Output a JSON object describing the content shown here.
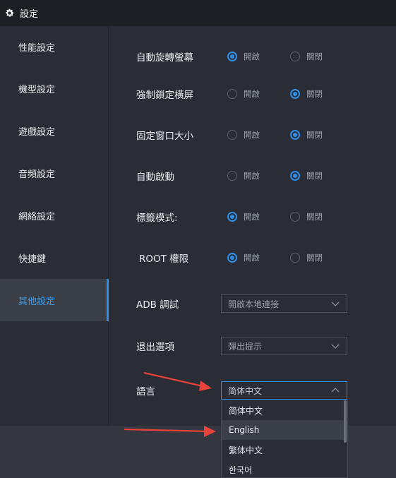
{
  "window": {
    "title": "設定"
  },
  "sidebar": {
    "items": [
      {
        "label": "性能設定",
        "active": false
      },
      {
        "label": "機型設定",
        "active": false
      },
      {
        "label": "遊戲設定",
        "active": false
      },
      {
        "label": "音頻設定",
        "active": false
      },
      {
        "label": "網絡設定",
        "active": false
      },
      {
        "label": "快捷鍵",
        "active": false
      },
      {
        "label": "其他設定",
        "active": true
      }
    ]
  },
  "settings": {
    "rows": [
      {
        "label": "自動旋轉螢幕",
        "on": "開啟",
        "off": "關閉",
        "selected": "on"
      },
      {
        "label": "強制鎖定橫屏",
        "on": "開啟",
        "off": "關閉",
        "selected": "off"
      },
      {
        "label": "固定窗口大小",
        "on": "開啟",
        "off": "關閉",
        "selected": "off"
      },
      {
        "label": "自動啟動",
        "on": "開啟",
        "off": "關閉",
        "selected": "off"
      },
      {
        "label": "標籤模式:",
        "on": "開啟",
        "off": "關閉",
        "selected": "on"
      },
      {
        "label": "ROOT 權限",
        "on": "開啟",
        "off": "關閉",
        "selected": "on"
      }
    ],
    "adb": {
      "label": "ADB 調試",
      "value": "開啟本地連接"
    },
    "exit": {
      "label": "退出選項",
      "value": "彈出提示"
    },
    "language": {
      "label": "語言",
      "value": "简体中文",
      "options": [
        "简体中文",
        "English",
        "繁体中文",
        "한국어"
      ],
      "hovered": "English"
    }
  },
  "colors": {
    "accent": "#2f8fe8",
    "annotation_arrow": "#e8433a"
  }
}
